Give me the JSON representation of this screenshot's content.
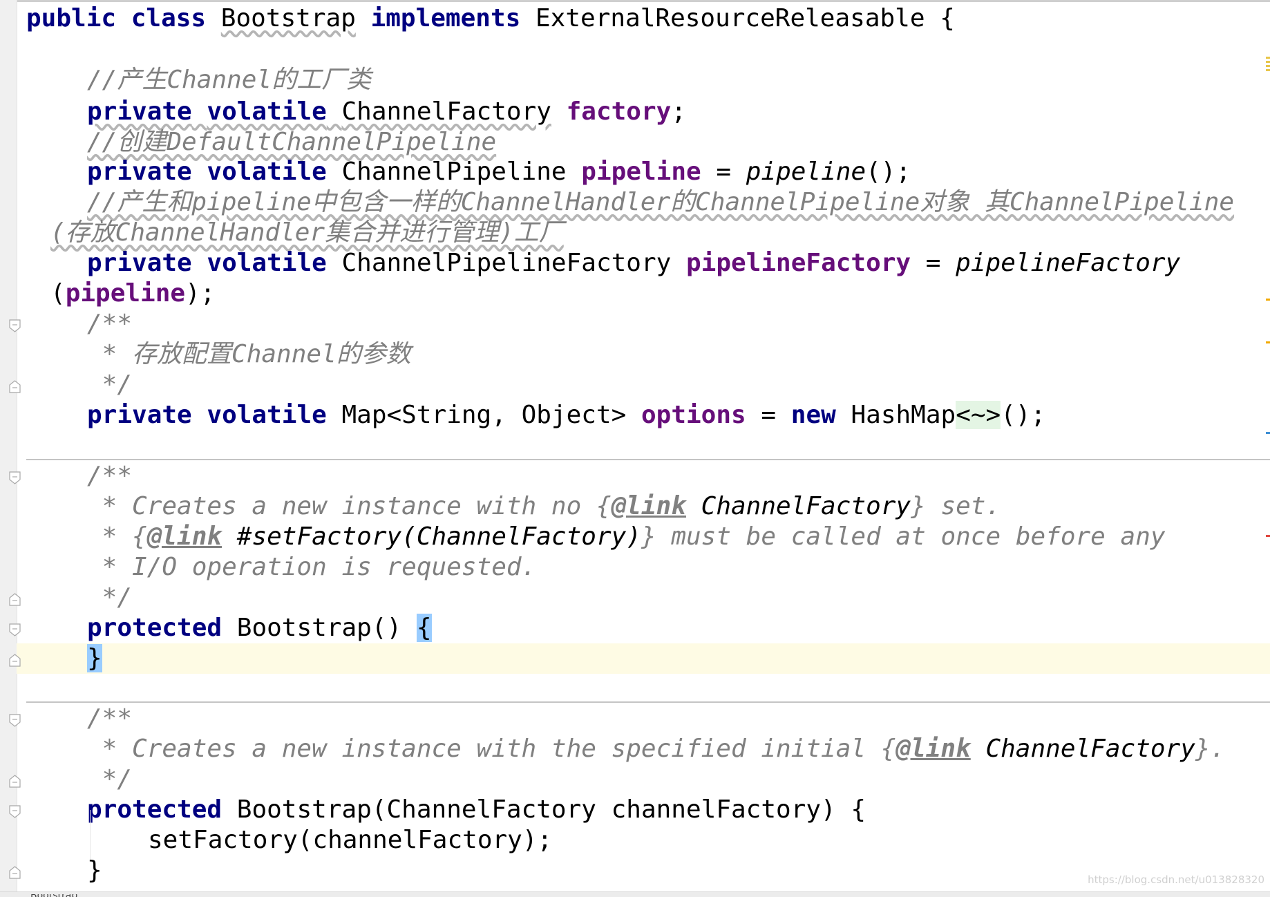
{
  "editor": {
    "language": "Java",
    "class_decl": {
      "kw_public": "public",
      "kw_class": "class",
      "name": "Bootstrap",
      "kw_implements": "implements",
      "iface": "ExternalResourceReleasable",
      "open": "{"
    },
    "comment_factory": "//产生Channel的工厂类",
    "field_factory": {
      "kw_private": "private",
      "kw_volatile": "volatile",
      "type": "ChannelFactory",
      "name": "factory",
      "semi": ";"
    },
    "comment_pipeline": "//创建DefaultChannelPipeline",
    "field_pipeline": {
      "kw_private": "private",
      "kw_volatile": "volatile",
      "type": "ChannelPipeline",
      "name": "pipeline",
      "eq": "=",
      "call": "pipeline",
      "tail": "();"
    },
    "comment_pipeline_factory_1": "//产生和pipeline中包含一样的ChannelHandler的ChannelPipeline对象 其ChannelPipeline",
    "comment_pipeline_factory_2": "(存放ChannelHandler集合并进行管理)工厂",
    "field_pipeline_factory": {
      "kw_private": "private",
      "kw_volatile": "volatile",
      "type": "ChannelPipelineFactory",
      "name": "pipelineFactory",
      "eq": "=",
      "call": "pipelineFactory",
      "open_paren": "(",
      "arg": "pipeline",
      "tail": ");"
    },
    "doc_options": {
      "open": "/**",
      "body": " * 存放配置Channel的参数",
      "close": " */"
    },
    "field_options": {
      "kw_private": "private",
      "kw_volatile": "volatile",
      "type": "Map<String, Object>",
      "name": "options",
      "eq": "=",
      "kw_new": "new",
      "ctor": "HashMap",
      "diamond": "<~>",
      "tail": "();"
    },
    "doc_ctor1": {
      "open": "/**",
      "l1_a": " * Creates a new instance with no {",
      "l1_tag": "@link",
      "l1_ref": "ChannelFactory",
      "l1_b": "} set.",
      "l2_a": " * {",
      "l2_tag": "@link",
      "l2_ref": "#setFactory(ChannelFactory)",
      "l2_b": "} must be called at once before any",
      "l3": " * I/O operation is requested.",
      "close": " */"
    },
    "ctor1": {
      "kw_protected": "protected",
      "sig": "Bootstrap()",
      "open": "{",
      "close": "}"
    },
    "doc_ctor2": {
      "open": "/**",
      "l1_a": " * Creates a new instance with the specified initial {",
      "l1_tag": "@link",
      "l1_ref": "ChannelFactory",
      "l1_b": "}.",
      "close": " */"
    },
    "ctor2": {
      "kw_protected": "protected",
      "sig": "Bootstrap(ChannelFactory channelFactory) {",
      "body": "setFactory(channelFactory);",
      "close": "}"
    }
  },
  "colors": {
    "keyword": "#000080",
    "field": "#660e7a",
    "comment": "#808080",
    "caret_row": "#fefbe4",
    "brace_highlight": "#99ccff"
  },
  "watermark": "https://blog.csdn.net/u013828320",
  "bottom_tab_stub": "Bootstrap"
}
